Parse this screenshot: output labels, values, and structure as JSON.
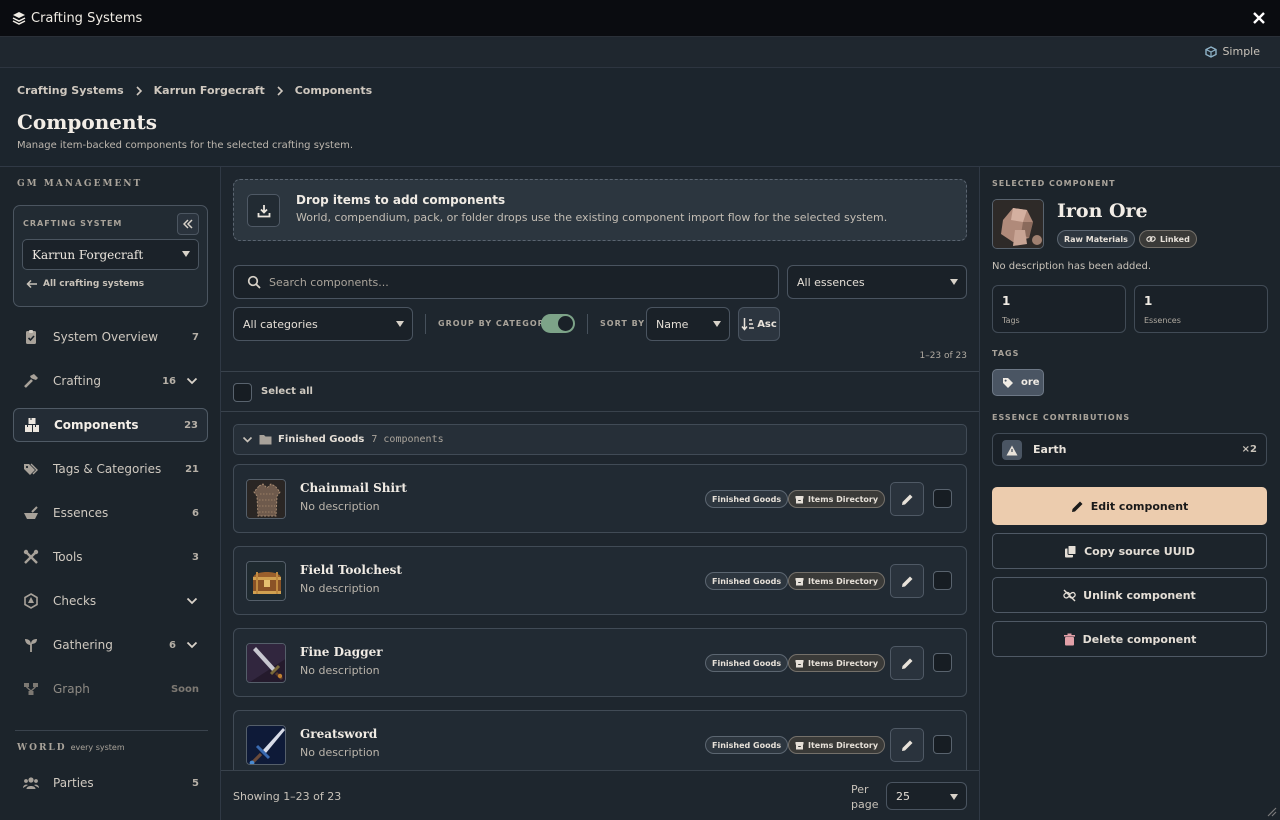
{
  "window": {
    "title": "Crafting Systems"
  },
  "toolbar": {
    "mode_label": "Simple"
  },
  "breadcrumb": [
    "Crafting Systems",
    "Karrun Forgecraft",
    "Components"
  ],
  "page": {
    "title": "Components",
    "subtitle": "Manage item-backed components for the selected crafting system."
  },
  "sidebar": {
    "section_label": "GM MANAGEMENT",
    "crafting_system_label": "CRAFTING SYSTEM",
    "selected_system": "Karrun Forgecraft",
    "all_systems_label": "All crafting systems",
    "items": [
      {
        "label": "System Overview",
        "count": "7",
        "icon": "clipboard-check-icon"
      },
      {
        "label": "Crafting",
        "count": "16",
        "icon": "hammer-icon",
        "expandable": true
      },
      {
        "label": "Components",
        "count": "23",
        "icon": "boxes-icon",
        "active": true
      },
      {
        "label": "Tags & Categories",
        "count": "21",
        "icon": "tags-icon"
      },
      {
        "label": "Essences",
        "count": "6",
        "icon": "mortar-icon"
      },
      {
        "label": "Tools",
        "count": "3",
        "icon": "tools-icon"
      },
      {
        "label": "Checks",
        "count": "",
        "icon": "dice-icon",
        "expandable": true
      },
      {
        "label": "Gathering",
        "count": "6",
        "icon": "seedling-icon",
        "expandable": true
      },
      {
        "label": "Graph",
        "count": "Soon",
        "icon": "graph-icon",
        "disabled": true
      }
    ],
    "world_label": "WORLD",
    "world_sub": "every system",
    "world_items": [
      {
        "label": "Parties",
        "count": "5",
        "icon": "users-icon"
      }
    ]
  },
  "dropzone": {
    "title": "Drop items to add components",
    "subtitle": "World, compendium, pack, or folder drops use the existing component import flow for the selected system."
  },
  "filters": {
    "search_placeholder": "Search components...",
    "essence_filter": "All essences",
    "category_filter": "All categories",
    "group_label": "GROUP BY CATEGORY",
    "group_enabled": true,
    "sort_label": "SORT BY",
    "sort_value": "Name",
    "sort_dir": "Asc",
    "range": "1–23 of 23"
  },
  "list": {
    "select_all_label": "Select all",
    "category": {
      "name": "Finished Goods",
      "count": "7 components"
    },
    "components": [
      {
        "name": "Chainmail Shirt",
        "desc": "No description",
        "category_tag": "Finished Goods",
        "source_tag": "Items Directory",
        "thumb": "chainmail-icon"
      },
      {
        "name": "Field Toolchest",
        "desc": "No description",
        "category_tag": "Finished Goods",
        "source_tag": "Items Directory",
        "thumb": "chest-icon"
      },
      {
        "name": "Fine Dagger",
        "desc": "No description",
        "category_tag": "Finished Goods",
        "source_tag": "Items Directory",
        "thumb": "dagger-icon"
      },
      {
        "name": "Greatsword",
        "desc": "No description",
        "category_tag": "Finished Goods",
        "source_tag": "Items Directory",
        "thumb": "sword-icon"
      }
    ]
  },
  "footer": {
    "showing": "Showing 1–23 of 23",
    "per_page_label": "Per page",
    "per_page": "25"
  },
  "selected": {
    "section_label": "SELECTED COMPONENT",
    "name": "Iron Ore",
    "category_badge": "Raw Materials",
    "linked_badge": "Linked",
    "description": "No description has been added.",
    "stats": [
      {
        "value": "1",
        "label": "Tags"
      },
      {
        "value": "1",
        "label": "Essences"
      }
    ],
    "tags_label": "TAGS",
    "tags": [
      "ore"
    ],
    "essence_label": "ESSENCE CONTRIBUTIONS",
    "essences": [
      {
        "name": "Earth",
        "qty": "×2"
      }
    ],
    "actions": {
      "edit": "Edit component",
      "copy": "Copy source UUID",
      "unlink": "Unlink component",
      "delete": "Delete component"
    }
  },
  "colors": {
    "accent": "#ecccae",
    "toggle_on": "#7da388",
    "panel_bg": "#1c242b",
    "delete": "#e2a0a8"
  }
}
